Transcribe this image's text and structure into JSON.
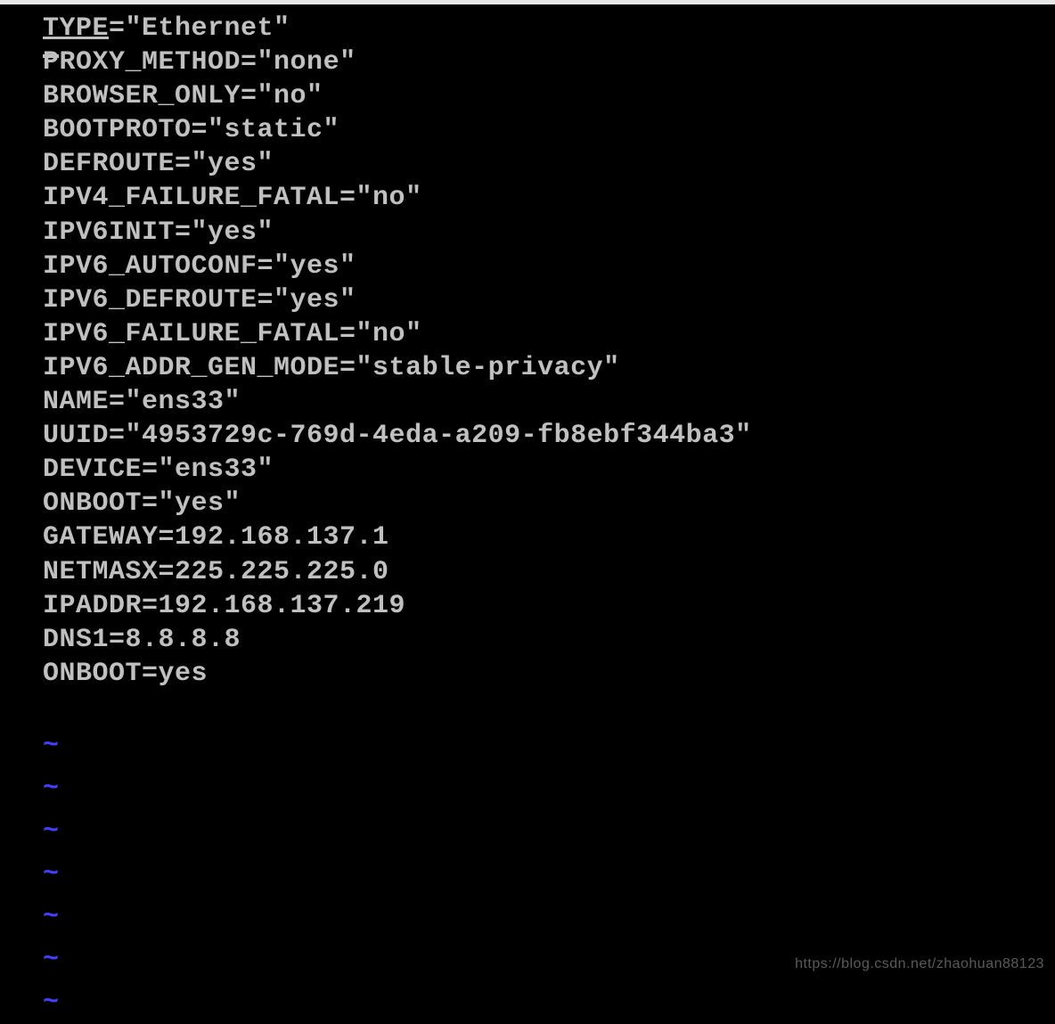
{
  "config": {
    "line0a": "T",
    "line0b": "YPE",
    "line0c": "=\"Ethernet\"",
    "line1a": "P",
    "line1b": "ROXY_METHOD=\"none\"",
    "line2": "BROWSER_ONLY=\"no\"",
    "line3": "BOOTPROTO=\"static\"",
    "line4": "DEFROUTE=\"yes\"",
    "line5": "IPV4_FAILURE_FATAL=\"no\"",
    "line6": "IPV6INIT=\"yes\"",
    "line7": "IPV6_AUTOCONF=\"yes\"",
    "line8": "IPV6_DEFROUTE=\"yes\"",
    "line9": "IPV6_FAILURE_FATAL=\"no\"",
    "line10": "IPV6_ADDR_GEN_MODE=\"stable-privacy\"",
    "line11": "NAME=\"ens33\"",
    "line12": "UUID=\"4953729c-769d-4eda-a209-fb8ebf344ba3\"",
    "line13": "DEVICE=\"ens33\"",
    "line14": "ONBOOT=\"yes\"",
    "line15": "GATEWAY=192.168.137.1",
    "line16": "NETMASX=225.225.225.0",
    "line17": "IPADDR=192.168.137.219",
    "line18": "DNS1=8.8.8.8",
    "line19": "ONBOOT=yes"
  },
  "tilde": "~",
  "watermark": "https://blog.csdn.net/zhaohuan88123"
}
